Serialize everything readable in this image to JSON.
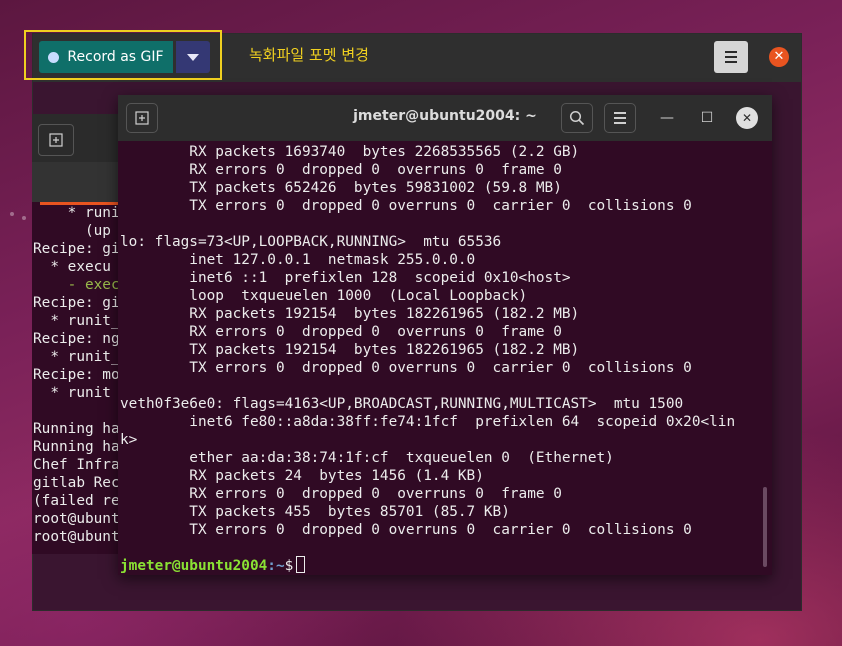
{
  "recorder": {
    "record_button_label": "Record as GIF",
    "annotation": "녹화파일 포멧 변경",
    "menu_icon": "hamburger-icon",
    "close_icon": "close-icon",
    "accent_color": "#0f6f69",
    "highlight_color": "#f0d020"
  },
  "terminal": {
    "title": "jmeter@ubuntu2004: ~",
    "prompt": {
      "user_host": "jmeter@ubuntu2004",
      "path": ":~",
      "symbol": "$"
    },
    "lines": [
      "        RX packets 1693740  bytes 2268535565 (2.2 GB)",
      "        RX errors 0  dropped 0  overruns 0  frame 0",
      "        TX packets 652426  bytes 59831002 (59.8 MB)",
      "        TX errors 0  dropped 0 overruns 0  carrier 0  collisions 0",
      "",
      "lo: flags=73<UP,LOOPBACK,RUNNING>  mtu 65536",
      "        inet 127.0.0.1  netmask 255.0.0.0",
      "        inet6 ::1  prefixlen 128  scopeid 0x10<host>",
      "        loop  txqueuelen 1000  (Local Loopback)",
      "        RX packets 192154  bytes 182261965 (182.2 MB)",
      "        RX errors 0  dropped 0  overruns 0  frame 0",
      "        TX packets 192154  bytes 182261965 (182.2 MB)",
      "        TX errors 0  dropped 0 overruns 0  carrier 0  collisions 0",
      "",
      "veth0f3e6e0: flags=4163<UP,BROADCAST,RUNNING,MULTICAST>  mtu 1500",
      "        inet6 fe80::a8da:38ff:fe74:1fcf  prefixlen 64  scopeid 0x20<lin",
      "k>",
      "        ether aa:da:38:74:1f:cf  txqueuelen 0  (Ethernet)",
      "        RX packets 24  bytes 1456 (1.4 KB)",
      "        RX errors 0  dropped 0  overruns 0  frame 0",
      "        TX packets 455  bytes 85701 (85.7 KB)",
      "        TX errors 0  dropped 0 overruns 0  carrier 0  collisions 0"
    ]
  },
  "background_terminal": {
    "lines": [
      "    * runi",
      "      (up i",
      "Recipe: gi",
      "  * execu",
      "    - exec",
      "Recipe: gi",
      "  * runit_",
      "Recipe: ng",
      "  * runit_",
      "Recipe: mo",
      "  * runit",
      "",
      "Running ha",
      "Running ha",
      "Chef Infra",
      "gitlab Rec",
      "(failed re",
      "root@ubunt",
      "root@ubunt"
    ]
  }
}
